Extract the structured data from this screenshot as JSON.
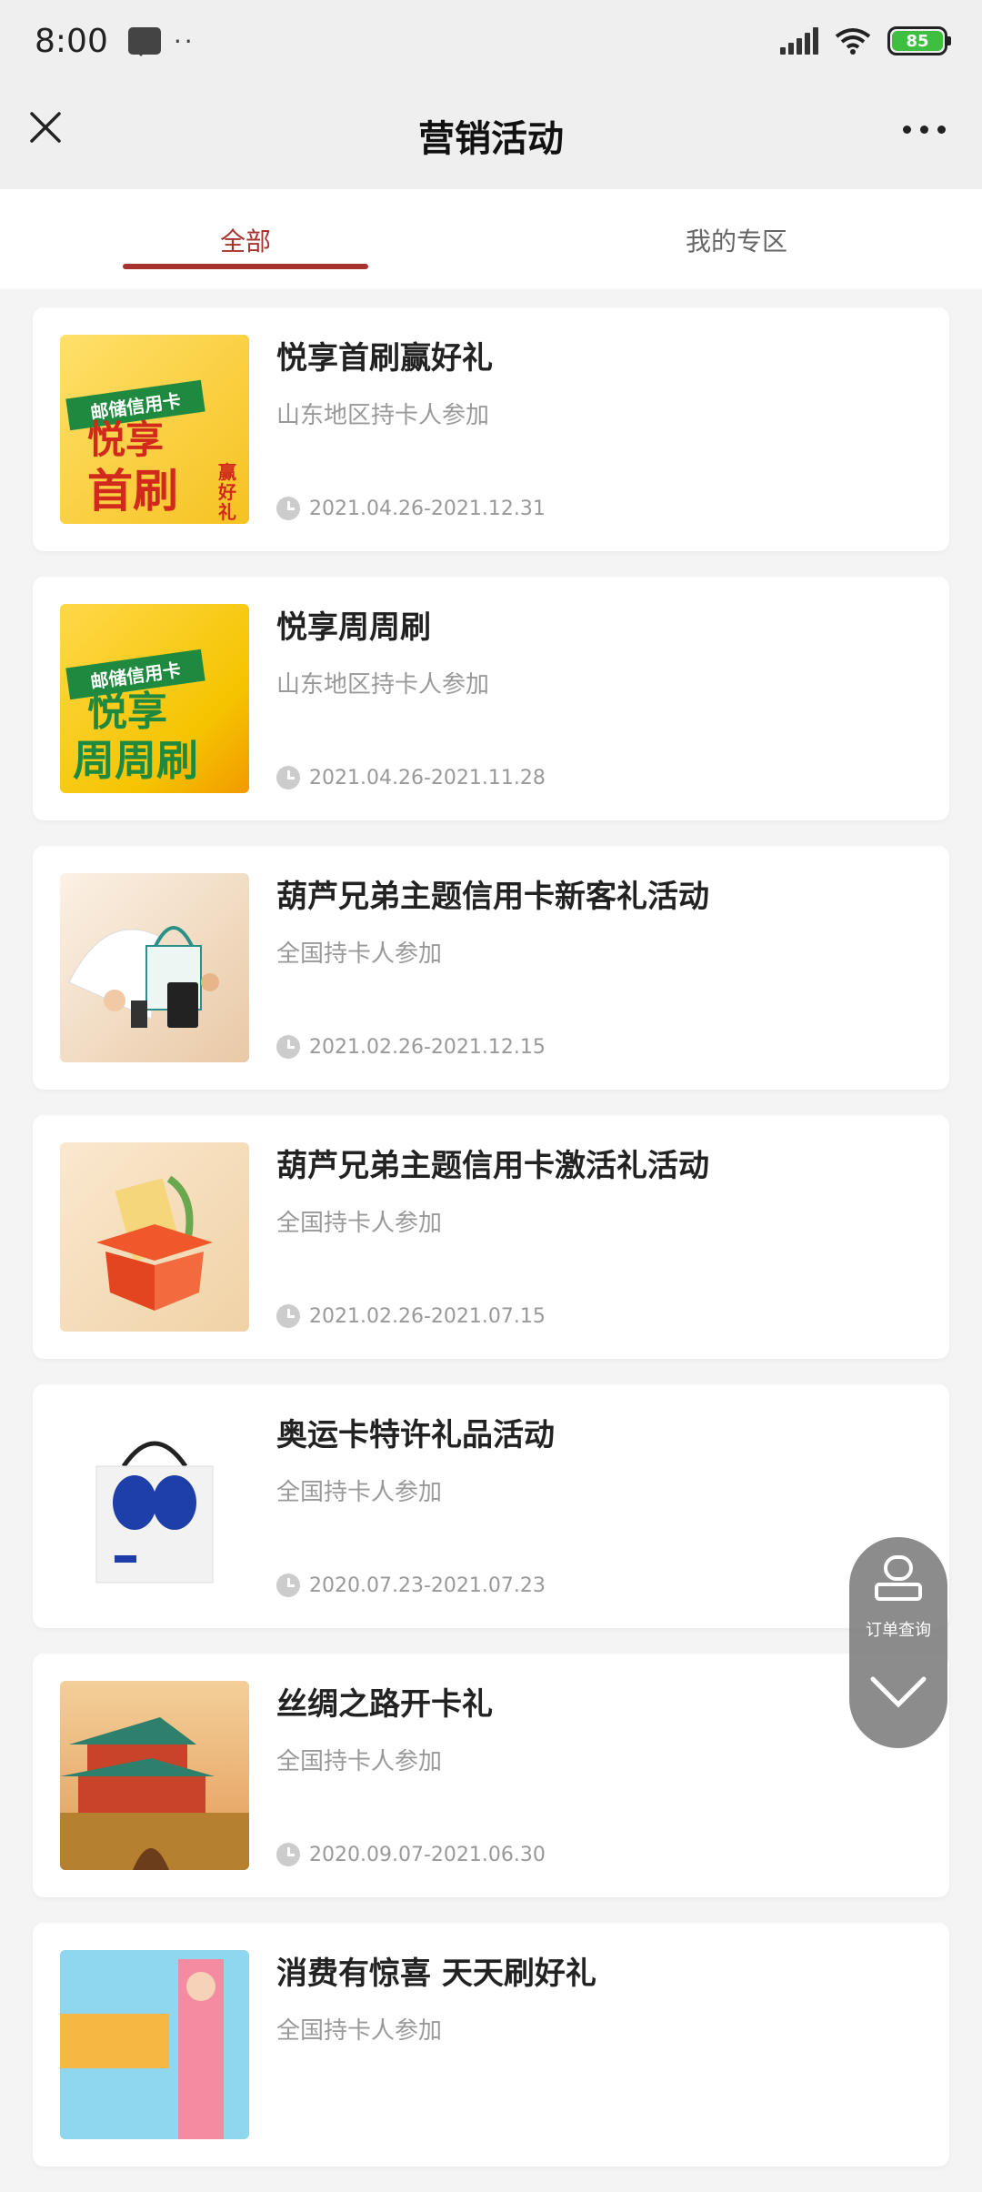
{
  "status": {
    "time": "8:00",
    "battery": "85"
  },
  "nav": {
    "title": "营销活动"
  },
  "tabs": [
    {
      "label": "全部",
      "active": true
    },
    {
      "label": "我的专区",
      "active": false
    }
  ],
  "activities": [
    {
      "title": "悦享首刷赢好礼",
      "subtitle": "山东地区持卡人参加",
      "date": "2021.04.26-2021.12.31"
    },
    {
      "title": "悦享周周刷",
      "subtitle": "山东地区持卡人参加",
      "date": "2021.04.26-2021.11.28"
    },
    {
      "title": "葫芦兄弟主题信用卡新客礼活动",
      "subtitle": "全国持卡人参加",
      "date": "2021.02.26-2021.12.15"
    },
    {
      "title": "葫芦兄弟主题信用卡激活礼活动",
      "subtitle": "全国持卡人参加",
      "date": "2021.02.26-2021.07.15"
    },
    {
      "title": "奥运卡特许礼品活动",
      "subtitle": "全国持卡人参加",
      "date": "2020.07.23-2021.07.23"
    },
    {
      "title": "丝绸之路开卡礼",
      "subtitle": "全国持卡人参加",
      "date": "2020.09.07-2021.06.30"
    },
    {
      "title": "消费有惊喜 天天刷好礼",
      "subtitle": "全国持卡人参加",
      "date": ""
    }
  ],
  "thumbs": {
    "t1": {
      "badge": "邮储信用卡",
      "line1": "悦享",
      "line2": "首刷",
      "side": "赢好礼"
    },
    "t2": {
      "badge": "邮储信用卡",
      "line1": "悦享",
      "line2": "周周刷"
    }
  },
  "float_button": {
    "label": "订单查询"
  },
  "colors": {
    "accent": "#a8322d",
    "background": "#f4f4f4"
  }
}
